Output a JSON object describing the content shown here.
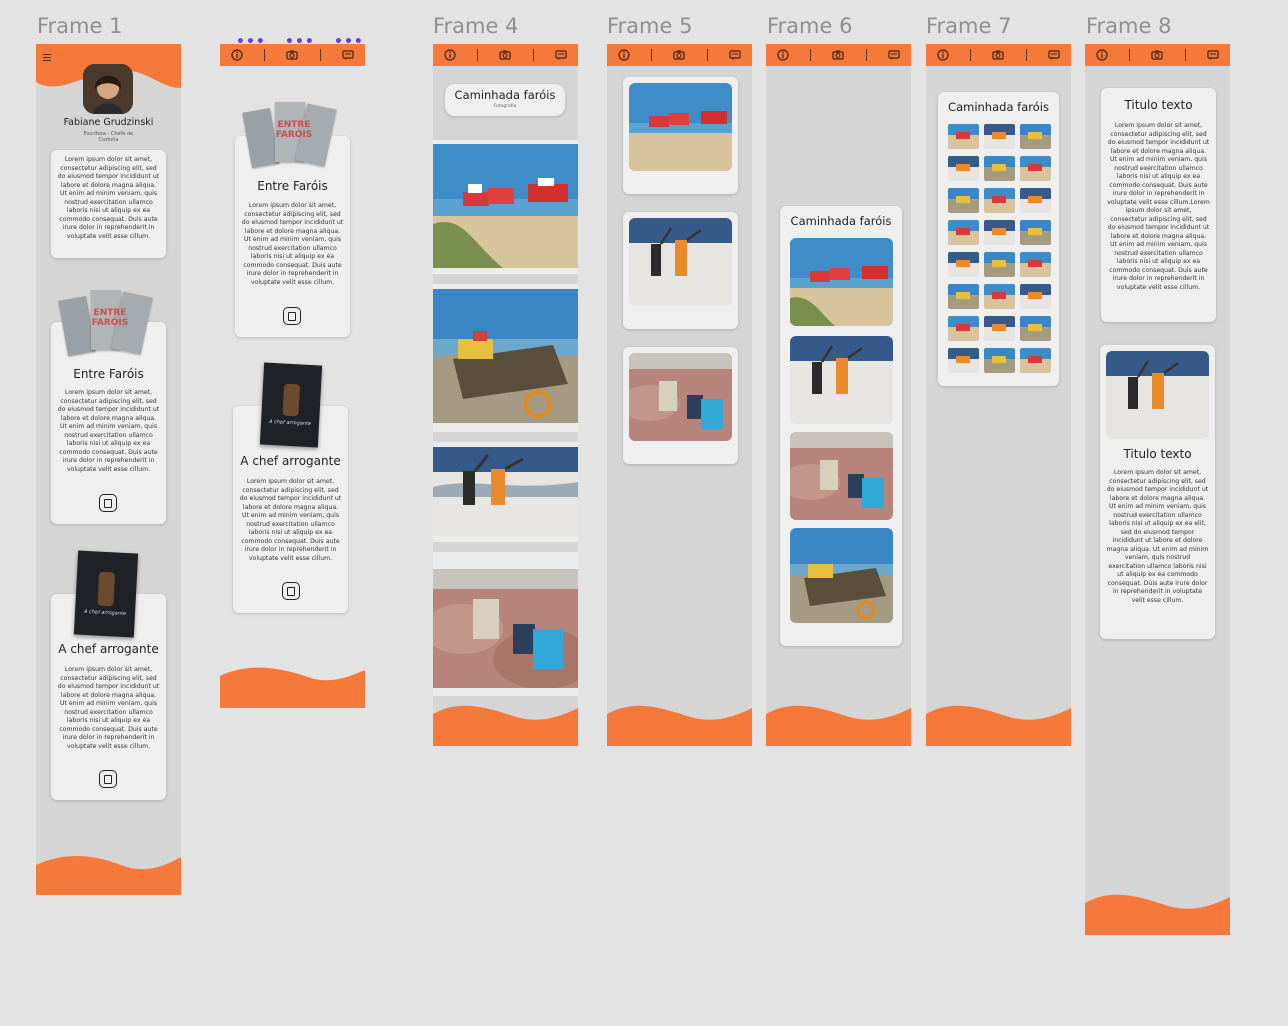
{
  "frame_titles": [
    "Frame 1",
    "Frame 4",
    "Frame 5",
    "Frame 6",
    "Frame 7",
    "Frame 8"
  ],
  "colors": {
    "accent": "#f4793b",
    "frame_bg": "#d5d5d5",
    "canvas_bg": "#e3e3e3",
    "card_bg": "#efefef",
    "selection_dots": "#6b3fd6"
  },
  "icons": {
    "info": "info-icon",
    "camera": "camera-icon",
    "message": "message-icon",
    "menu": "hamburger-menu-icon",
    "bag": "shopping-bag-icon"
  },
  "selection_dots": "•••",
  "lorem": "Lorem ipsum dolor sit amet, consectetur adipiscing elit, sed do eiusmod tempor incididunt ut labore et dolore magna aliqua. Ut enim ad minim veniam, quis nostrud exercitation ullamco laboris nisi ut aliquip ex ea commodo consequat. Duis aute irure dolor in reprehenderit in voluptate velit esse cillum.",
  "frame1": {
    "profile_name": "Fabiane Grudzinski",
    "profile_role": "Escritora - Chefe de Cozinha",
    "books": [
      {
        "title": "Entre Faróis",
        "cover_text": "ENTRE FARÓIS"
      },
      {
        "title": "A chef arrogante",
        "cover_text": "A chef arrogante"
      }
    ]
  },
  "frame2": {
    "books": [
      {
        "title": "Entre Faróis",
        "cover_text": "ENTRE FARÓIS"
      },
      {
        "title": "A chef arrogante",
        "cover_text": "A chef arrogante"
      }
    ]
  },
  "frame4": {
    "album_title": "Caminhada faróis",
    "album_subtitle": "Fotografia"
  },
  "frame6": {
    "album_title": "Caminhada faróis"
  },
  "frame7": {
    "album_title": "Caminhada faróis",
    "grid_rows": 8,
    "grid_cols": 3
  },
  "frame8": {
    "text_title_1": "Titulo texto",
    "text_body_1": "Lorem ipsum dolor sit amet, consectetur adipiscing elit, sed do eiusmod tempor incididunt ut labore et dolore magna aliqua. Ut enim ad minim veniam, quis nostrud exercitation ullamco laboris nisi ut aliquip ex ea commodo consequat. Duis aute irure dolor in reprehenderit in voluptate velit esse cillum.Lorem ipsum dolor sit amet, consectetur adipiscing elit, sed do eiusmod tempor incididunt ut labore et dolore magna aliqua. Ut enim ad minim veniam, quis nostrud exercitation ullamco laboris nisi ut aliquip ex ea commodo consequat. Duis aute irure dolor in reprehenderit in voluptate velit esse cillum.",
    "text_title_2": "Titulo texto",
    "text_body_2": "Lorem ipsum dolor sit amet, consectetur adipiscing elit, sed do eiusmod tempor incididunt ut labore et dolore magna aliqua. Ut enim ad minim veniam, quis nostrud exercitation ullamco laboris nisi ut aliquip ex ea elit, sed do eiusmod tempor incididunt ut labore et dolore magna aliqua. Ut enim ad minim veniam, quis nostrud exercitation ullamco laboris nisi ut aliquip ex ea commodo consequat. Duis aute irure dolor in reprehenderit in voluptate velit esse cillum."
  }
}
